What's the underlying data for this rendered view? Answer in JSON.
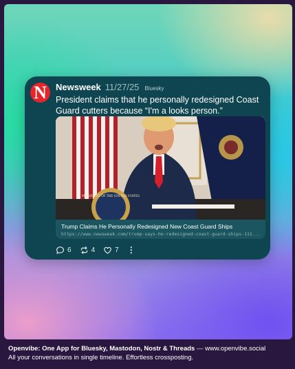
{
  "post": {
    "avatar_letter": "N",
    "avatar_color": "#e6252b",
    "author": "Newsweek",
    "date": "11/27/25",
    "network": "Bluesky",
    "text": "President claims that he personally redesigned Coast Guard cutters because “I'm a looks person.”",
    "link_preview": {
      "image_desc": "news-photo",
      "seal_text": "PRESIDENT OF THE UNITED STATES",
      "title": "Trump Claims He Personally Redesigned New Coast Guard Ships",
      "url": "https://www.newsweek.com/trump-says-he-redesigned-coast-guard-ships-111..."
    },
    "actions": {
      "replies": "6",
      "reposts": "4",
      "likes": "7",
      "more_icon": "more-vertical-icon"
    }
  },
  "footer": {
    "brand": "Openvibe: One App for Bluesky, Mastodon, Nostr & Threads",
    "separator": " — ",
    "site": "www.openvibe.social",
    "tagline": "All your conversations in single timeline. Effortless crossposting."
  },
  "colors": {
    "card_bg": "#0e4550",
    "page_bg": "#2a1740"
  }
}
